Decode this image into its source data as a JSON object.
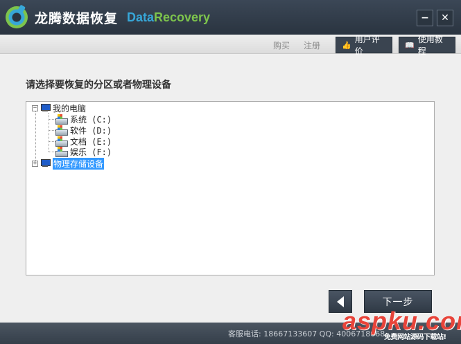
{
  "titlebar": {
    "app_name": "龙腾数据恢复",
    "brand_part1": "Data",
    "brand_part2": "Recovery",
    "minimize_label": "−",
    "close_label": "✕"
  },
  "toolbar": {
    "buy_label": "购买",
    "register_label": "注册",
    "review_label": "用户评价",
    "tutorial_label": "使用教程",
    "review_icon": "thumbs-up-icon",
    "tutorial_icon": "book-icon"
  },
  "main": {
    "prompt": "请选择要恢复的分区或者物理设备",
    "tree": {
      "computer_node": {
        "label": "我的电脑",
        "expander": "⊟"
      },
      "drives": [
        {
          "label": "系统 (C:)"
        },
        {
          "label": "软件 (D:)"
        },
        {
          "label": "文档 (E:)"
        },
        {
          "label": "娱乐 (F:)"
        }
      ],
      "physical_node": {
        "label": "物理存储设备",
        "expander": "⊞",
        "selected": true
      }
    }
  },
  "navigation": {
    "back_icon": "chevron-left-icon",
    "next_label": "下一步"
  },
  "footer": {
    "contact": "客服电话: 18667133607 QQ: 4006718068"
  },
  "watermark": {
    "logo_text": "aspku.com",
    "slogan": "免费网站源码下载站!"
  },
  "colors": {
    "titlebar": "#2f3a46",
    "brand_blue": "#37a7d8",
    "brand_green": "#7dc44c",
    "selection": "#3399ff",
    "watermark_red": "#e8443a"
  }
}
